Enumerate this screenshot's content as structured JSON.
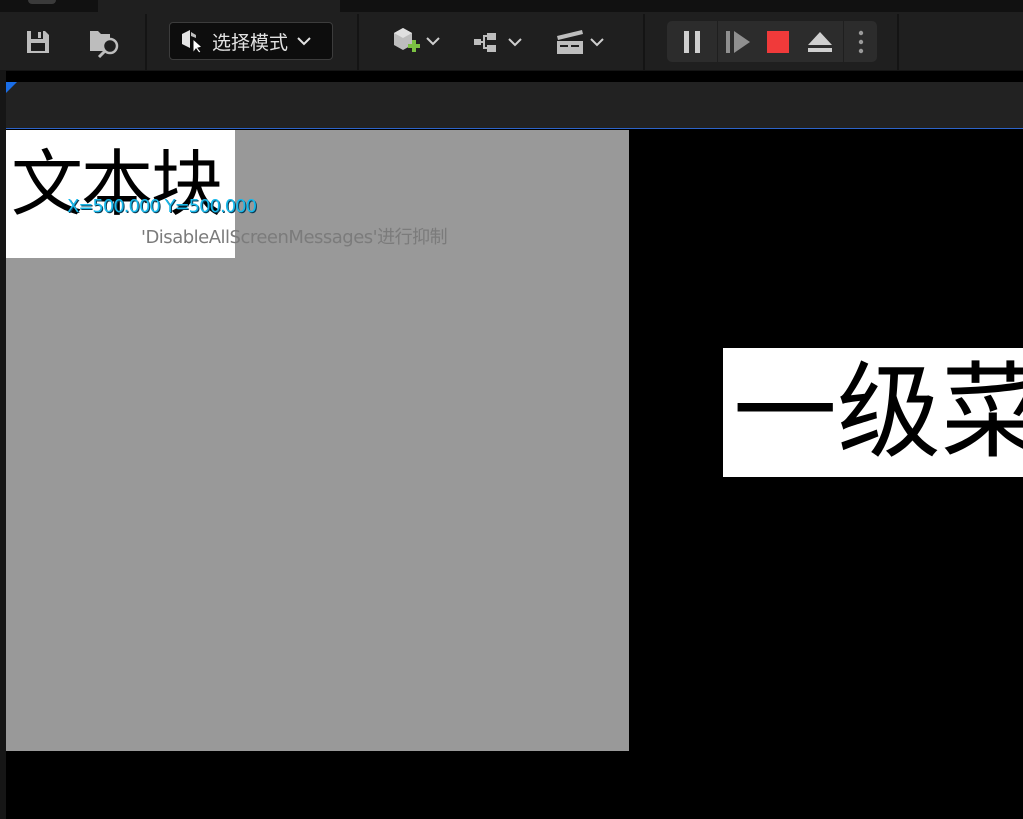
{
  "toolbar": {
    "mode_label": "选择模式",
    "icons": [
      "save-icon",
      "browse-content-icon",
      "select-mode-icon",
      "add-actor-icon",
      "blueprint-icon",
      "cinematics-icon",
      "pause-icon",
      "frame-skip-icon",
      "stop-icon",
      "eject-icon",
      "more-options-icon"
    ],
    "colors": {
      "stop": "#f03a3a",
      "add_plus": "#7bc142",
      "bg": "#1f1f1f"
    }
  },
  "viewport": {
    "text_block": "文本块",
    "menu_block": "一级菜",
    "coords": "X=500.000 Y=500.000",
    "hint": "'DisableAllScreenMessages'进行抑制",
    "colors": {
      "coords": "#17b8ea",
      "canvas": "#999999",
      "accent": "#1a6ee8"
    }
  }
}
